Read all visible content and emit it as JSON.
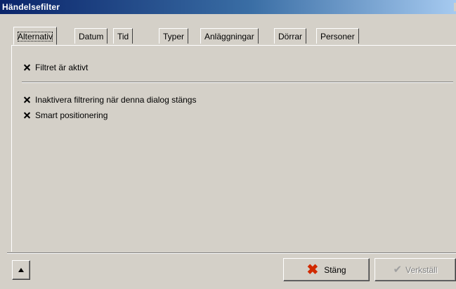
{
  "window": {
    "title": "Händelsefilter"
  },
  "tabs": [
    {
      "label": "Alternativ",
      "active": true
    },
    {
      "label": "Datum"
    },
    {
      "label": "Tid"
    },
    {
      "label": "Typer"
    },
    {
      "label": "Anläggningar"
    },
    {
      "label": "Dörrar"
    },
    {
      "label": "Personer"
    }
  ],
  "options": {
    "filter_active": {
      "label": "Filtret är aktivt",
      "checked": true
    },
    "disable_on_close": {
      "label": "Inaktivera filtrering när denna dialog stängs",
      "checked": true
    },
    "smart_positioning": {
      "label": "Smart positionering",
      "checked": true
    }
  },
  "footer": {
    "collapse_icon": "triangle-up-icon",
    "close_label": "Stäng",
    "close_icon": "red-x-icon",
    "apply_label": "Verkställ",
    "apply_icon": "checkmark-icon",
    "apply_enabled": false
  }
}
